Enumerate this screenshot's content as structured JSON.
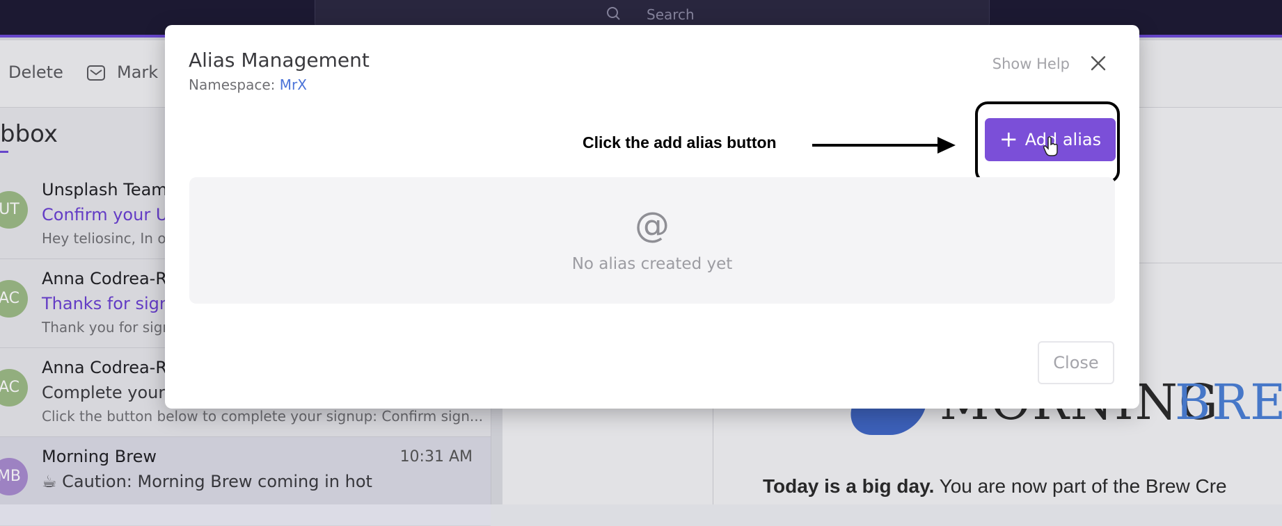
{
  "search": {
    "placeholder": "Search"
  },
  "toolbar": {
    "delete_label": "Delete",
    "mark_label": "Mark"
  },
  "inbox": {
    "title_fragment": "bbox"
  },
  "mails": [
    {
      "initials": "UT",
      "avatar_color": "#9dbb86",
      "sender": "Unsplash Team",
      "subject": "Confirm your U",
      "preview": "Hey teliosinc, In or",
      "time": ""
    },
    {
      "initials": "AC",
      "avatar_color": "#9dbb86",
      "sender": "Anna Codrea-Ra",
      "subject": "Thanks for signi",
      "preview": "Thank you for sign",
      "time": ""
    },
    {
      "initials": "AC",
      "avatar_color": "#9dbb86",
      "sender": "Anna Codrea-Ra",
      "subject": "Complete your",
      "preview": "Click the button below to complete your signup: Confirm sign...",
      "time": ""
    },
    {
      "initials": "MB",
      "avatar_color": "#a98bd0",
      "sender": "Morning Brew",
      "subject": "☕ Caution: Morning Brew coming in hot",
      "preview": "",
      "time": "10:31 AM"
    }
  ],
  "reading_pane": {
    "brand_part1": "MORNING",
    "brand_part2": "BREW",
    "tagline_bold": "Today is a big day.",
    "tagline_rest": " You are now part of the Brew Cre"
  },
  "modal": {
    "title": "Alias Management",
    "namespace_label": "Namespace: ",
    "namespace_value": "MrX",
    "show_help": "Show Help",
    "add_alias_label": "Add alias",
    "empty_icon": "@",
    "empty_text": "No alias created yet",
    "close_label": "Close"
  },
  "annotation": {
    "text": "Click the add alias button"
  },
  "colors": {
    "accent": "#7b4fd8",
    "link": "#4b73d8",
    "topbar": "#1d1a33"
  },
  "icons": [
    "search-icon",
    "envelope-icon",
    "close-icon",
    "plus-icon",
    "hand-cursor-icon",
    "at-icon"
  ]
}
